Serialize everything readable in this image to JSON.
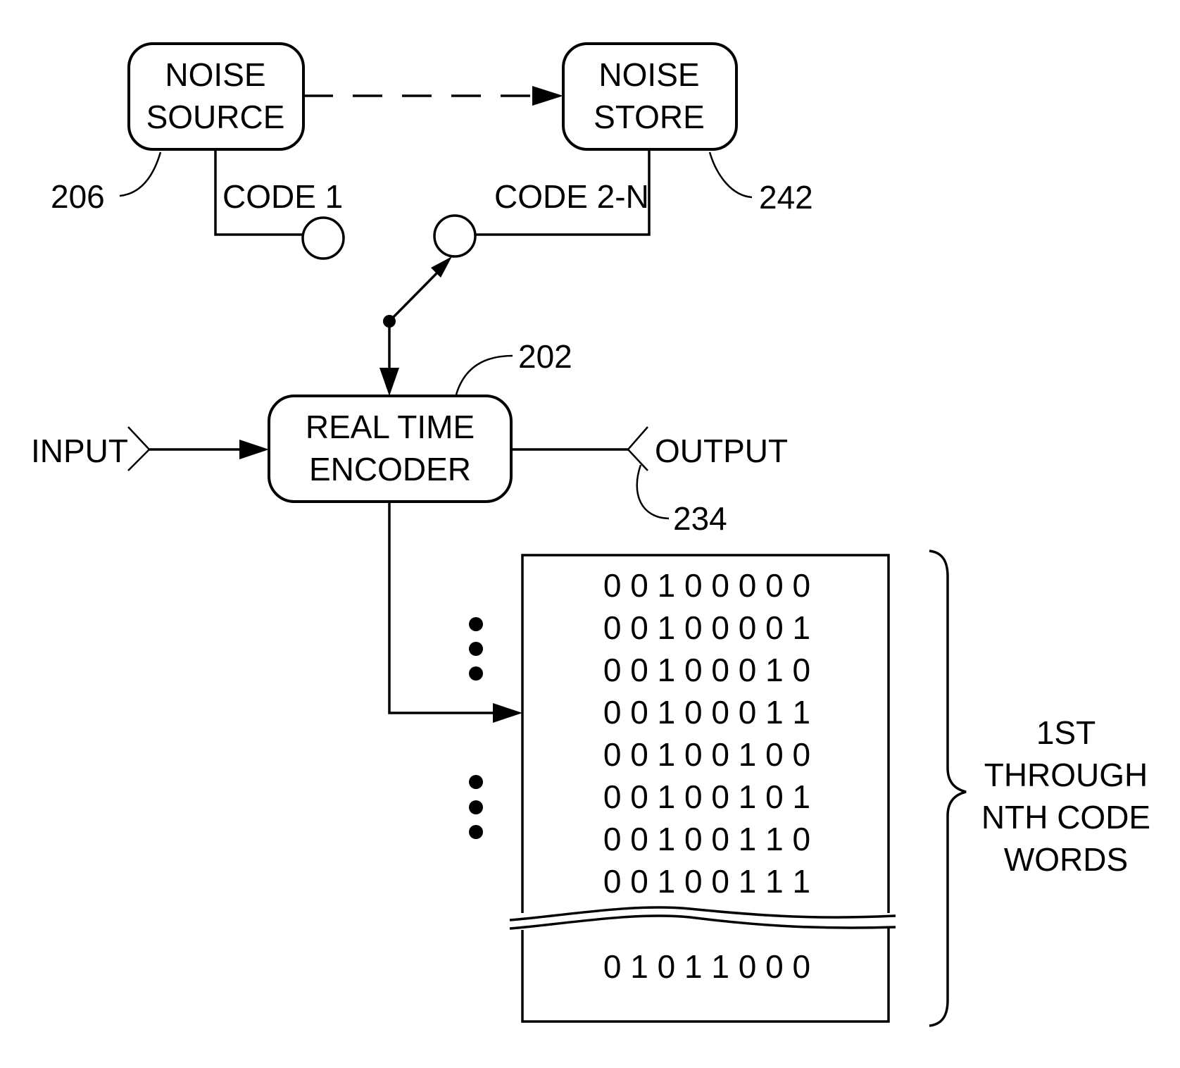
{
  "blocks": {
    "noise_source": {
      "line1": "NOISE",
      "line2": "SOURCE",
      "ref": "206"
    },
    "noise_store": {
      "line1": "NOISE",
      "line2": "STORE",
      "ref": "242"
    },
    "encoder": {
      "line1": "REAL TIME",
      "line2": "ENCODER",
      "ref": "202"
    }
  },
  "labels": {
    "code1": "CODE 1",
    "code2n": "CODE 2-N",
    "input": "INPUT",
    "output": "OUTPUT",
    "output_ref": "234"
  },
  "code_table": {
    "rows": [
      "0 0 1 0 0 0 0 0",
      "0 0 1 0 0 0 0 1",
      "0 0 1 0 0 0 1 0",
      "0 0 1 0 0 0 1 1",
      "0 0 1 0 0 1 0 0",
      "0 0 1 0 0 1 0 1",
      "0 0 1 0 0 1 1 0",
      "0 0 1 0 0 1 1 1"
    ],
    "last_row": "0 1 0 1 1 0 0 0"
  },
  "brace_label": {
    "line1": "1ST",
    "line2": "THROUGH",
    "line3": "NTH CODE",
    "line4": "WORDS"
  }
}
